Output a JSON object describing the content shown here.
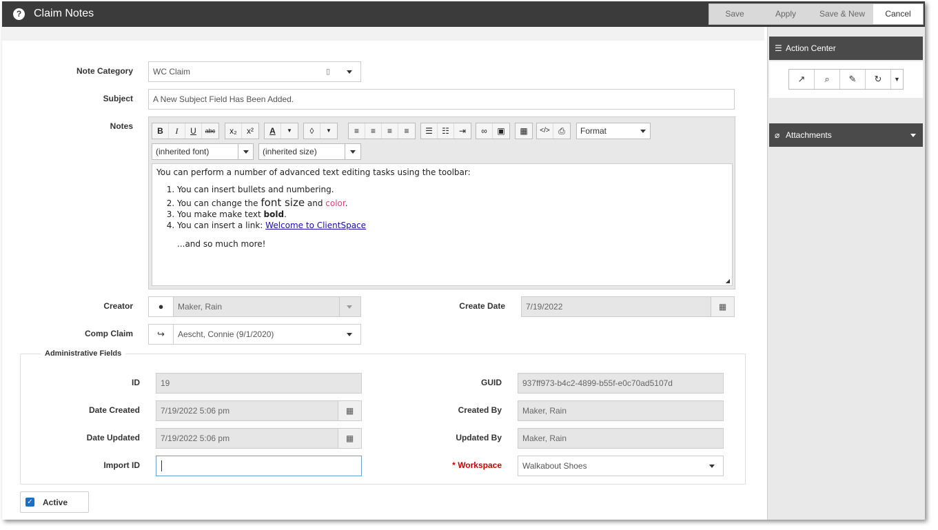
{
  "window": {
    "title": "Claim Notes"
  },
  "toolbar": {
    "save": "Save",
    "apply": "Apply",
    "save_new": "Save & New",
    "cancel": "Cancel"
  },
  "form": {
    "note_category": {
      "label": "Note Category",
      "value": "WC Claim"
    },
    "subject": {
      "label": "Subject",
      "value": "A New Subject Field Has Been Added."
    },
    "notes": {
      "label": "Notes",
      "font_select": "(inherited font)",
      "size_select": "(inherited size)",
      "format_select": "Format",
      "intro": "You can perform a number of advanced text editing tasks using the toolbar:",
      "item1": "You can insert bullets and numbering.",
      "item2_pre": "You can change the ",
      "item2_big": "font size",
      "item2_mid": " and ",
      "item2_color": "color",
      "item2_end": ".",
      "item3_pre": "You make make text ",
      "item3_bold": "bold",
      "item3_end": ".",
      "item4_pre": "You can insert a link: ",
      "item4_link": "Welcome to ClientSpace",
      "outro": "...and so much more!"
    },
    "creator": {
      "label": "Creator",
      "value": "Maker, Rain"
    },
    "create_date": {
      "label": "Create Date",
      "value": "7/19/2022"
    },
    "comp_claim": {
      "label": "Comp Claim",
      "value": "Aescht, Connie (9/1/2020)"
    }
  },
  "admin": {
    "legend": "Administrative Fields",
    "id": {
      "label": "ID",
      "value": "19"
    },
    "guid": {
      "label": "GUID",
      "value": "937ff973-b4c2-4899-b55f-e0c70ad5107d"
    },
    "date_created": {
      "label": "Date Created",
      "value": "7/19/2022 5:06 pm"
    },
    "created_by": {
      "label": "Created By",
      "value": "Maker, Rain"
    },
    "date_updated": {
      "label": "Date Updated",
      "value": "7/19/2022 5:06 pm"
    },
    "updated_by": {
      "label": "Updated By",
      "value": "Maker, Rain"
    },
    "import_id": {
      "label": "Import ID",
      "value": ""
    },
    "workspace": {
      "required_mark": "*",
      "label": "Workspace",
      "value": "Walkabout Shoes"
    }
  },
  "active": {
    "label": "Active",
    "checked": true
  },
  "sidebar": {
    "action_center": "Action Center",
    "attachments": "Attachments"
  }
}
